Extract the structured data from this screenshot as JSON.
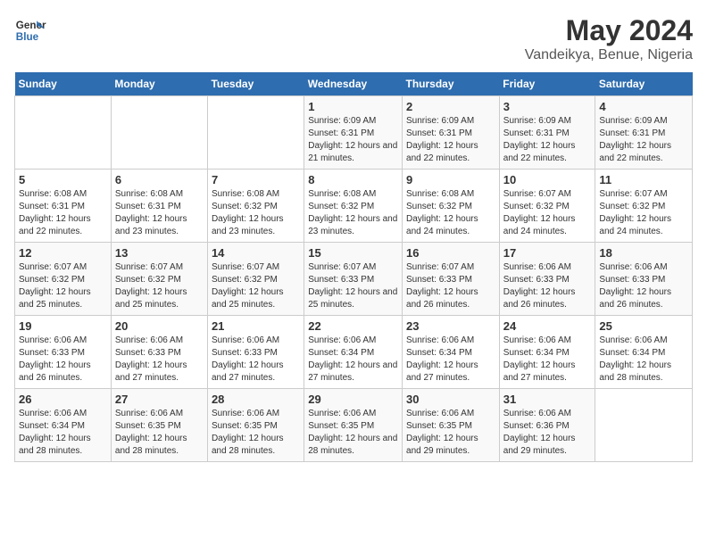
{
  "header": {
    "logo_line1": "General",
    "logo_line2": "Blue",
    "title": "May 2024",
    "subtitle": "Vandeikya, Benue, Nigeria"
  },
  "weekdays": [
    "Sunday",
    "Monday",
    "Tuesday",
    "Wednesday",
    "Thursday",
    "Friday",
    "Saturday"
  ],
  "weeks": [
    [
      {
        "day": "",
        "sunrise": "",
        "sunset": "",
        "daylight": ""
      },
      {
        "day": "",
        "sunrise": "",
        "sunset": "",
        "daylight": ""
      },
      {
        "day": "",
        "sunrise": "",
        "sunset": "",
        "daylight": ""
      },
      {
        "day": "1",
        "sunrise": "Sunrise: 6:09 AM",
        "sunset": "Sunset: 6:31 PM",
        "daylight": "Daylight: 12 hours and 21 minutes."
      },
      {
        "day": "2",
        "sunrise": "Sunrise: 6:09 AM",
        "sunset": "Sunset: 6:31 PM",
        "daylight": "Daylight: 12 hours and 22 minutes."
      },
      {
        "day": "3",
        "sunrise": "Sunrise: 6:09 AM",
        "sunset": "Sunset: 6:31 PM",
        "daylight": "Daylight: 12 hours and 22 minutes."
      },
      {
        "day": "4",
        "sunrise": "Sunrise: 6:09 AM",
        "sunset": "Sunset: 6:31 PM",
        "daylight": "Daylight: 12 hours and 22 minutes."
      }
    ],
    [
      {
        "day": "5",
        "sunrise": "Sunrise: 6:08 AM",
        "sunset": "Sunset: 6:31 PM",
        "daylight": "Daylight: 12 hours and 22 minutes."
      },
      {
        "day": "6",
        "sunrise": "Sunrise: 6:08 AM",
        "sunset": "Sunset: 6:31 PM",
        "daylight": "Daylight: 12 hours and 23 minutes."
      },
      {
        "day": "7",
        "sunrise": "Sunrise: 6:08 AM",
        "sunset": "Sunset: 6:32 PM",
        "daylight": "Daylight: 12 hours and 23 minutes."
      },
      {
        "day": "8",
        "sunrise": "Sunrise: 6:08 AM",
        "sunset": "Sunset: 6:32 PM",
        "daylight": "Daylight: 12 hours and 23 minutes."
      },
      {
        "day": "9",
        "sunrise": "Sunrise: 6:08 AM",
        "sunset": "Sunset: 6:32 PM",
        "daylight": "Daylight: 12 hours and 24 minutes."
      },
      {
        "day": "10",
        "sunrise": "Sunrise: 6:07 AM",
        "sunset": "Sunset: 6:32 PM",
        "daylight": "Daylight: 12 hours and 24 minutes."
      },
      {
        "day": "11",
        "sunrise": "Sunrise: 6:07 AM",
        "sunset": "Sunset: 6:32 PM",
        "daylight": "Daylight: 12 hours and 24 minutes."
      }
    ],
    [
      {
        "day": "12",
        "sunrise": "Sunrise: 6:07 AM",
        "sunset": "Sunset: 6:32 PM",
        "daylight": "Daylight: 12 hours and 25 minutes."
      },
      {
        "day": "13",
        "sunrise": "Sunrise: 6:07 AM",
        "sunset": "Sunset: 6:32 PM",
        "daylight": "Daylight: 12 hours and 25 minutes."
      },
      {
        "day": "14",
        "sunrise": "Sunrise: 6:07 AM",
        "sunset": "Sunset: 6:32 PM",
        "daylight": "Daylight: 12 hours and 25 minutes."
      },
      {
        "day": "15",
        "sunrise": "Sunrise: 6:07 AM",
        "sunset": "Sunset: 6:33 PM",
        "daylight": "Daylight: 12 hours and 25 minutes."
      },
      {
        "day": "16",
        "sunrise": "Sunrise: 6:07 AM",
        "sunset": "Sunset: 6:33 PM",
        "daylight": "Daylight: 12 hours and 26 minutes."
      },
      {
        "day": "17",
        "sunrise": "Sunrise: 6:06 AM",
        "sunset": "Sunset: 6:33 PM",
        "daylight": "Daylight: 12 hours and 26 minutes."
      },
      {
        "day": "18",
        "sunrise": "Sunrise: 6:06 AM",
        "sunset": "Sunset: 6:33 PM",
        "daylight": "Daylight: 12 hours and 26 minutes."
      }
    ],
    [
      {
        "day": "19",
        "sunrise": "Sunrise: 6:06 AM",
        "sunset": "Sunset: 6:33 PM",
        "daylight": "Daylight: 12 hours and 26 minutes."
      },
      {
        "day": "20",
        "sunrise": "Sunrise: 6:06 AM",
        "sunset": "Sunset: 6:33 PM",
        "daylight": "Daylight: 12 hours and 27 minutes."
      },
      {
        "day": "21",
        "sunrise": "Sunrise: 6:06 AM",
        "sunset": "Sunset: 6:33 PM",
        "daylight": "Daylight: 12 hours and 27 minutes."
      },
      {
        "day": "22",
        "sunrise": "Sunrise: 6:06 AM",
        "sunset": "Sunset: 6:34 PM",
        "daylight": "Daylight: 12 hours and 27 minutes."
      },
      {
        "day": "23",
        "sunrise": "Sunrise: 6:06 AM",
        "sunset": "Sunset: 6:34 PM",
        "daylight": "Daylight: 12 hours and 27 minutes."
      },
      {
        "day": "24",
        "sunrise": "Sunrise: 6:06 AM",
        "sunset": "Sunset: 6:34 PM",
        "daylight": "Daylight: 12 hours and 27 minutes."
      },
      {
        "day": "25",
        "sunrise": "Sunrise: 6:06 AM",
        "sunset": "Sunset: 6:34 PM",
        "daylight": "Daylight: 12 hours and 28 minutes."
      }
    ],
    [
      {
        "day": "26",
        "sunrise": "Sunrise: 6:06 AM",
        "sunset": "Sunset: 6:34 PM",
        "daylight": "Daylight: 12 hours and 28 minutes."
      },
      {
        "day": "27",
        "sunrise": "Sunrise: 6:06 AM",
        "sunset": "Sunset: 6:35 PM",
        "daylight": "Daylight: 12 hours and 28 minutes."
      },
      {
        "day": "28",
        "sunrise": "Sunrise: 6:06 AM",
        "sunset": "Sunset: 6:35 PM",
        "daylight": "Daylight: 12 hours and 28 minutes."
      },
      {
        "day": "29",
        "sunrise": "Sunrise: 6:06 AM",
        "sunset": "Sunset: 6:35 PM",
        "daylight": "Daylight: 12 hours and 28 minutes."
      },
      {
        "day": "30",
        "sunrise": "Sunrise: 6:06 AM",
        "sunset": "Sunset: 6:35 PM",
        "daylight": "Daylight: 12 hours and 29 minutes."
      },
      {
        "day": "31",
        "sunrise": "Sunrise: 6:06 AM",
        "sunset": "Sunset: 6:36 PM",
        "daylight": "Daylight: 12 hours and 29 minutes."
      },
      {
        "day": "",
        "sunrise": "",
        "sunset": "",
        "daylight": ""
      }
    ]
  ]
}
